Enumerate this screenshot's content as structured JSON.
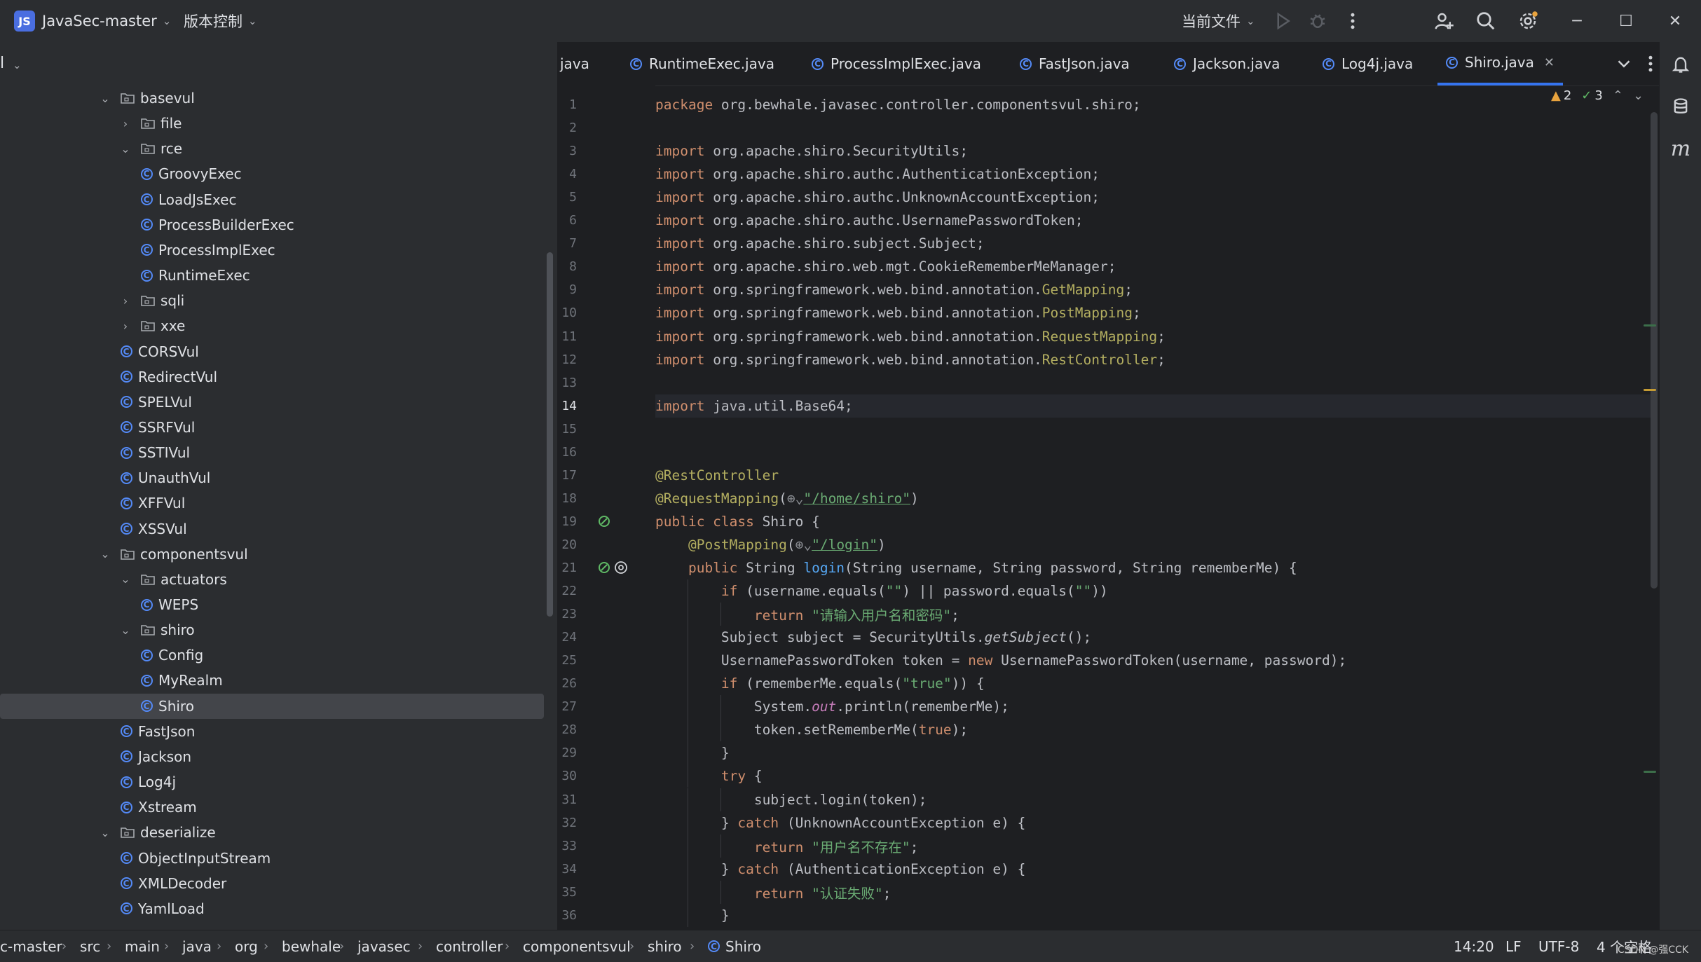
{
  "titlebar": {
    "project_badge": "JS",
    "project_name": "JavaSec-master",
    "vcs_label": "版本控制",
    "run_config": "当前文件"
  },
  "project_panel": {
    "header": "l"
  },
  "tree": [
    {
      "label": "basevul",
      "type": "folder",
      "depth": 0,
      "expanded": true
    },
    {
      "label": "file",
      "type": "folder",
      "depth": 1,
      "expanded": false
    },
    {
      "label": "rce",
      "type": "folder",
      "depth": 1,
      "expanded": true
    },
    {
      "label": "GroovyExec",
      "type": "class",
      "depth": 2
    },
    {
      "label": "LoadJsExec",
      "type": "class",
      "depth": 2
    },
    {
      "label": "ProcessBuilderExec",
      "type": "class",
      "depth": 2
    },
    {
      "label": "ProcessImplExec",
      "type": "class",
      "depth": 2
    },
    {
      "label": "RuntimeExec",
      "type": "class",
      "depth": 2
    },
    {
      "label": "sqli",
      "type": "folder",
      "depth": 1,
      "expanded": false
    },
    {
      "label": "xxe",
      "type": "folder",
      "depth": 1,
      "expanded": false
    },
    {
      "label": "CORSVul",
      "type": "class",
      "depth": 1
    },
    {
      "label": "RedirectVul",
      "type": "class",
      "depth": 1
    },
    {
      "label": "SPELVul",
      "type": "class",
      "depth": 1
    },
    {
      "label": "SSRFVul",
      "type": "class",
      "depth": 1
    },
    {
      "label": "SSTIVul",
      "type": "class",
      "depth": 1
    },
    {
      "label": "UnauthVul",
      "type": "class",
      "depth": 1
    },
    {
      "label": "XFFVul",
      "type": "class",
      "depth": 1
    },
    {
      "label": "XSSVul",
      "type": "class",
      "depth": 1
    },
    {
      "label": "componentsvul",
      "type": "folder",
      "depth": 0,
      "expanded": true
    },
    {
      "label": "actuators",
      "type": "folder",
      "depth": 1,
      "expanded": true
    },
    {
      "label": "WEPS",
      "type": "class",
      "depth": 2
    },
    {
      "label": "shiro",
      "type": "folder",
      "depth": 1,
      "expanded": true
    },
    {
      "label": "Config",
      "type": "class",
      "depth": 2
    },
    {
      "label": "MyRealm",
      "type": "class",
      "depth": 2
    },
    {
      "label": "Shiro",
      "type": "class",
      "depth": 2,
      "selected": true
    },
    {
      "label": "FastJson",
      "type": "class",
      "depth": 1
    },
    {
      "label": "Jackson",
      "type": "class",
      "depth": 1
    },
    {
      "label": "Log4j",
      "type": "class",
      "depth": 1
    },
    {
      "label": "Xstream",
      "type": "class",
      "depth": 1
    },
    {
      "label": "deserialize",
      "type": "folder",
      "depth": 0,
      "expanded": true
    },
    {
      "label": "ObjectInputStream",
      "type": "class",
      "depth": 1
    },
    {
      "label": "XMLDecoder",
      "type": "class",
      "depth": 1
    },
    {
      "label": "YamlLoad",
      "type": "class",
      "depth": 1
    }
  ],
  "tabs": [
    {
      "label": "java",
      "icon": false
    },
    {
      "label": "RuntimeExec.java",
      "icon": true
    },
    {
      "label": "ProcessImplExec.java",
      "icon": true
    },
    {
      "label": "FastJson.java",
      "icon": true
    },
    {
      "label": "Jackson.java",
      "icon": true
    },
    {
      "label": "Log4j.java",
      "icon": true
    },
    {
      "label": "Shiro.java",
      "icon": true,
      "active": true
    }
  ],
  "inspection": {
    "warnings": "2",
    "passed": "3"
  },
  "code": [
    {
      "n": "1",
      "html": "<span class='kw'>package</span> org.bewhale.javasec.controller.componentsvul.shiro;"
    },
    {
      "n": "2",
      "html": ""
    },
    {
      "n": "3",
      "html": "<span class='kw'>import</span> org.apache.shiro.SecurityUtils;"
    },
    {
      "n": "4",
      "html": "<span class='kw'>import</span> org.apache.shiro.authc.AuthenticationException;"
    },
    {
      "n": "5",
      "html": "<span class='kw'>import</span> org.apache.shiro.authc.UnknownAccountException;"
    },
    {
      "n": "6",
      "html": "<span class='kw'>import</span> org.apache.shiro.authc.UsernamePasswordToken;"
    },
    {
      "n": "7",
      "html": "<span class='kw'>import</span> org.apache.shiro.subject.Subject;"
    },
    {
      "n": "8",
      "html": "<span class='kw'>import</span> org.apache.shiro.web.mgt.CookieRememberMeManager;"
    },
    {
      "n": "9",
      "html": "<span class='kw'>import</span> org.springframework.web.bind.annotation.<span class='ann'>GetMapping</span>;"
    },
    {
      "n": "10",
      "html": "<span class='kw'>import</span> org.springframework.web.bind.annotation.<span class='ann'>PostMapping</span>;"
    },
    {
      "n": "11",
      "html": "<span class='kw'>import</span> org.springframework.web.bind.annotation.<span class='ann'>RequestMapping</span>;"
    },
    {
      "n": "12",
      "html": "<span class='kw'>import</span> org.springframework.web.bind.annotation.<span class='ann'>RestController</span>;"
    },
    {
      "n": "13",
      "html": ""
    },
    {
      "n": "14",
      "html": "<span class='kw'>import</span> java.util.Base64;",
      "current": true
    },
    {
      "n": "15",
      "html": ""
    },
    {
      "n": "16",
      "html": ""
    },
    {
      "n": "17",
      "html": "<span class='ann'>@RestController</span>"
    },
    {
      "n": "18",
      "html": "<span class='ann'>@RequestMapping</span>(<span style='color:#8c8f94'>⊕⌄</span><span class='str' style='text-decoration:underline'>\"/home/shiro\"</span>)"
    },
    {
      "n": "19",
      "html": "<span class='kw'>public class</span> Shiro {"
    },
    {
      "n": "20",
      "html": "    <span class='ann'>@PostMapping</span>(<span style='color:#8c8f94'>⊕⌄</span><span class='str' style='text-decoration:underline'>\"/login\"</span>)"
    },
    {
      "n": "21",
      "html": "    <span class='kw'>public</span> String <span class='fn'>login</span>(String username, String password, String rememberMe) {"
    },
    {
      "n": "22",
      "html": "        <span class='kw'>if</span> (username.equals(<span class='str'>\"\"</span>) || password.equals(<span class='str'>\"\"</span>))"
    },
    {
      "n": "23",
      "html": "            <span class='kw'>return</span> <span class='str'>\"请输入用户名和密码\"</span>;"
    },
    {
      "n": "24",
      "html": "        Subject subject = SecurityUtils.<span class='sfn'>getSubject</span>();"
    },
    {
      "n": "25",
      "html": "        UsernamePasswordToken token = <span class='kw'>new</span> UsernamePasswordToken(username, password);"
    },
    {
      "n": "26",
      "html": "        <span class='kw'>if</span> (rememberMe.equals(<span class='str'>\"true\"</span>)) {"
    },
    {
      "n": "27",
      "html": "            System.<span class='it'>out</span>.println(rememberMe);"
    },
    {
      "n": "28",
      "html": "            token.setRememberMe(<span class='kw'>true</span>);"
    },
    {
      "n": "29",
      "html": "        }"
    },
    {
      "n": "30",
      "html": "        <span class='kw'>try</span> {"
    },
    {
      "n": "31",
      "html": "            subject.login(token);"
    },
    {
      "n": "32",
      "html": "        } <span class='kw'>catch</span> (UnknownAccountException e) {"
    },
    {
      "n": "33",
      "html": "            <span class='kw'>return</span> <span class='str'>\"用户名不存在\"</span>;"
    },
    {
      "n": "34",
      "html": "        } <span class='kw'>catch</span> (AuthenticationException e) {"
    },
    {
      "n": "35",
      "html": "            <span class='kw'>return</span> <span class='str'>\"认证失败\"</span>;"
    },
    {
      "n": "36",
      "html": "        }"
    }
  ],
  "breadcrumbs": [
    "c-master",
    "src",
    "main",
    "java",
    "org",
    "bewhale",
    "javasec",
    "controller",
    "componentsvul",
    "shiro",
    "Shiro"
  ],
  "status": {
    "position": "14:20",
    "line_sep": "LF",
    "encoding": "UTF-8",
    "indent": "4 个空格"
  },
  "watermark": "CSDN @强CCK",
  "colors": {
    "accent": "#3574f0",
    "class_icon": "#548af7",
    "keyword": "#cf8e6d",
    "string": "#6aab73",
    "annotation": "#b3ae60"
  }
}
